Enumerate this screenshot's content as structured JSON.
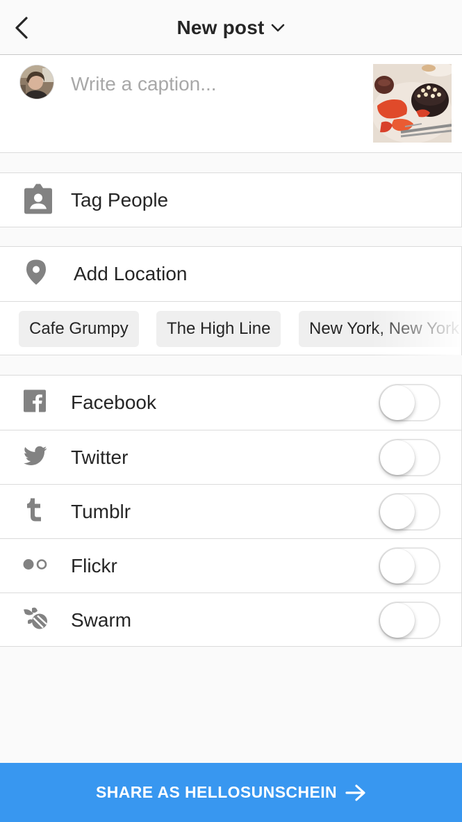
{
  "header": {
    "title": "New post"
  },
  "caption": {
    "placeholder": "Write a caption...",
    "value": ""
  },
  "tag_people": {
    "label": "Tag People",
    "icon": "tag-person-icon"
  },
  "location": {
    "label": "Add Location",
    "icon": "location-pin-icon",
    "suggestions": [
      "Cafe Grumpy",
      "The High Line",
      "New York, New York"
    ]
  },
  "share_targets": [
    {
      "label": "Facebook",
      "icon": "facebook-icon",
      "enabled": false
    },
    {
      "label": "Twitter",
      "icon": "twitter-icon",
      "enabled": false
    },
    {
      "label": "Tumblr",
      "icon": "tumblr-icon",
      "enabled": false
    },
    {
      "label": "Flickr",
      "icon": "flickr-icon",
      "enabled": false
    },
    {
      "label": "Swarm",
      "icon": "swarm-icon",
      "enabled": false
    }
  ],
  "share_button": {
    "label": "SHARE AS HELLOSUNSCHEIN",
    "color": "#3897f0"
  },
  "colors": {
    "accent": "#3897f0",
    "icon_gray": "#828282",
    "placeholder": "#a8a8a8"
  }
}
